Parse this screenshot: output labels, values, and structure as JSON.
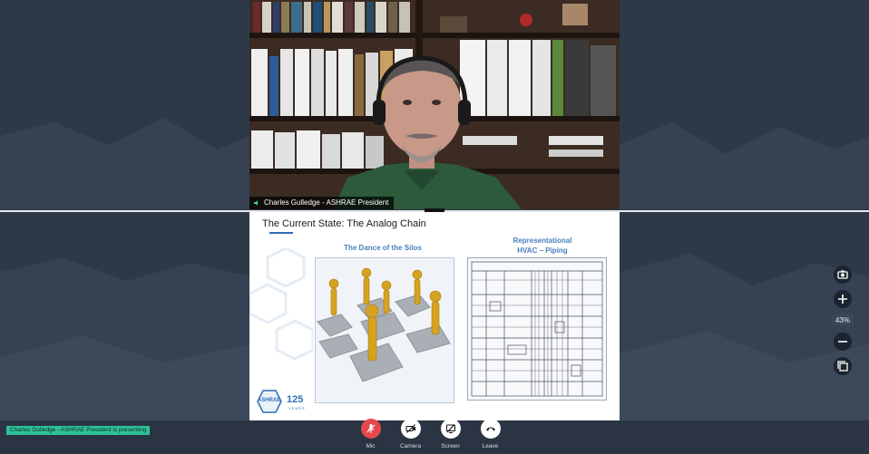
{
  "video": {
    "speaker_label": "Charles Gulledge - ASHRAE President"
  },
  "slide": {
    "title": "The Current State: The Analog Chain",
    "left_heading": "The Dance of the Silos",
    "right_heading_line1": "Representational",
    "right_heading_line2": "HVAC – Piping",
    "logo_word": "ASHRAE",
    "logo_celebrating": "CELEBRATING",
    "logo_number": "125",
    "logo_years": "YEARS"
  },
  "zoom": {
    "level": "43%"
  },
  "status": {
    "presenting_text": "Charles Gulledge - ASHRAE President is presenting"
  },
  "controls": {
    "mic_label": "Mic",
    "camera_label": "Camera",
    "screen_label": "Screen",
    "leave_label": "Leave"
  },
  "colors": {
    "background": "#2e3948",
    "accent_blue": "#4a7fbf",
    "presenting_badge": "#2fc19a",
    "mic_muted": "#e5484d"
  }
}
